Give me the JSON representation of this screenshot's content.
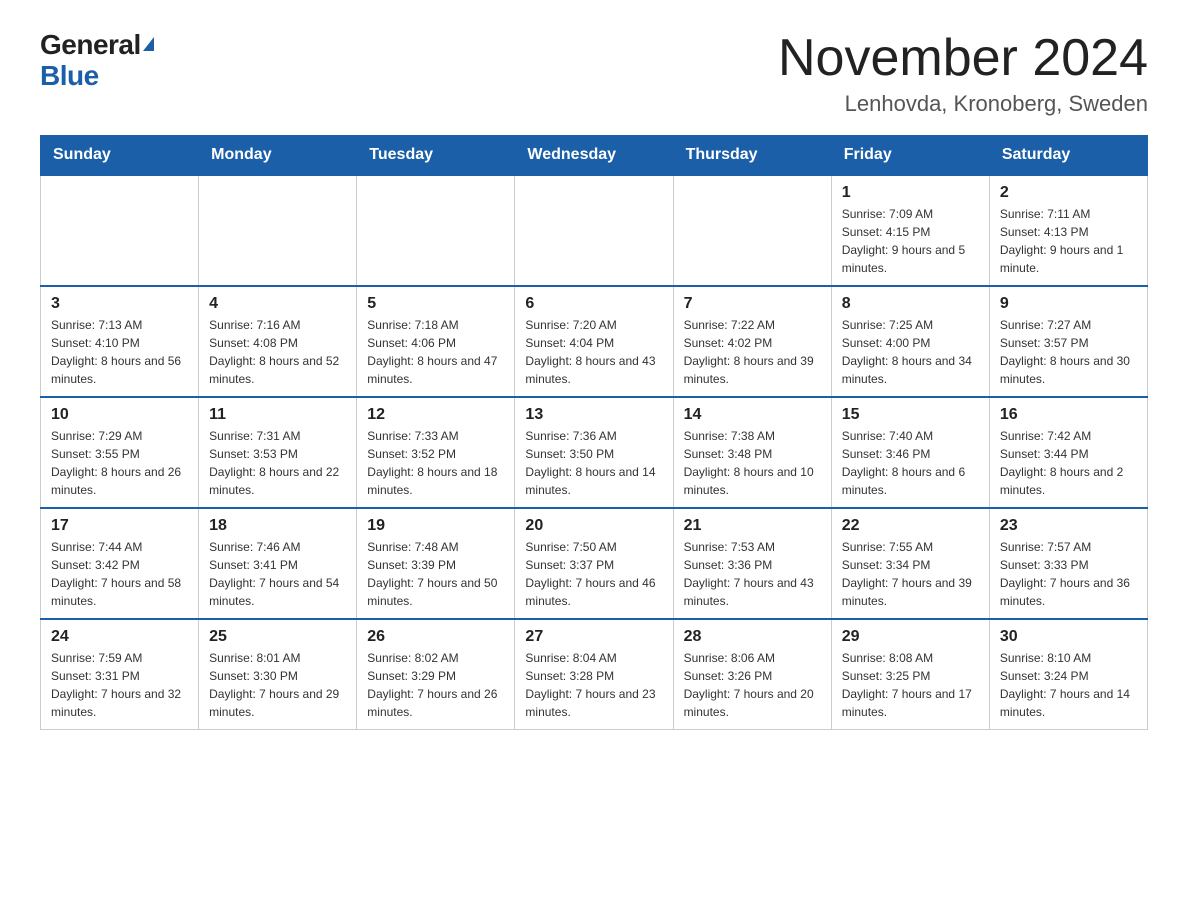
{
  "logo": {
    "text_general": "General",
    "text_blue": "Blue"
  },
  "title": "November 2024",
  "subtitle": "Lenhovda, Kronoberg, Sweden",
  "days_of_week": [
    "Sunday",
    "Monday",
    "Tuesday",
    "Wednesday",
    "Thursday",
    "Friday",
    "Saturday"
  ],
  "weeks": [
    [
      {
        "day": "",
        "info": ""
      },
      {
        "day": "",
        "info": ""
      },
      {
        "day": "",
        "info": ""
      },
      {
        "day": "",
        "info": ""
      },
      {
        "day": "",
        "info": ""
      },
      {
        "day": "1",
        "info": "Sunrise: 7:09 AM\nSunset: 4:15 PM\nDaylight: 9 hours and 5 minutes."
      },
      {
        "day": "2",
        "info": "Sunrise: 7:11 AM\nSunset: 4:13 PM\nDaylight: 9 hours and 1 minute."
      }
    ],
    [
      {
        "day": "3",
        "info": "Sunrise: 7:13 AM\nSunset: 4:10 PM\nDaylight: 8 hours and 56 minutes."
      },
      {
        "day": "4",
        "info": "Sunrise: 7:16 AM\nSunset: 4:08 PM\nDaylight: 8 hours and 52 minutes."
      },
      {
        "day": "5",
        "info": "Sunrise: 7:18 AM\nSunset: 4:06 PM\nDaylight: 8 hours and 47 minutes."
      },
      {
        "day": "6",
        "info": "Sunrise: 7:20 AM\nSunset: 4:04 PM\nDaylight: 8 hours and 43 minutes."
      },
      {
        "day": "7",
        "info": "Sunrise: 7:22 AM\nSunset: 4:02 PM\nDaylight: 8 hours and 39 minutes."
      },
      {
        "day": "8",
        "info": "Sunrise: 7:25 AM\nSunset: 4:00 PM\nDaylight: 8 hours and 34 minutes."
      },
      {
        "day": "9",
        "info": "Sunrise: 7:27 AM\nSunset: 3:57 PM\nDaylight: 8 hours and 30 minutes."
      }
    ],
    [
      {
        "day": "10",
        "info": "Sunrise: 7:29 AM\nSunset: 3:55 PM\nDaylight: 8 hours and 26 minutes."
      },
      {
        "day": "11",
        "info": "Sunrise: 7:31 AM\nSunset: 3:53 PM\nDaylight: 8 hours and 22 minutes."
      },
      {
        "day": "12",
        "info": "Sunrise: 7:33 AM\nSunset: 3:52 PM\nDaylight: 8 hours and 18 minutes."
      },
      {
        "day": "13",
        "info": "Sunrise: 7:36 AM\nSunset: 3:50 PM\nDaylight: 8 hours and 14 minutes."
      },
      {
        "day": "14",
        "info": "Sunrise: 7:38 AM\nSunset: 3:48 PM\nDaylight: 8 hours and 10 minutes."
      },
      {
        "day": "15",
        "info": "Sunrise: 7:40 AM\nSunset: 3:46 PM\nDaylight: 8 hours and 6 minutes."
      },
      {
        "day": "16",
        "info": "Sunrise: 7:42 AM\nSunset: 3:44 PM\nDaylight: 8 hours and 2 minutes."
      }
    ],
    [
      {
        "day": "17",
        "info": "Sunrise: 7:44 AM\nSunset: 3:42 PM\nDaylight: 7 hours and 58 minutes."
      },
      {
        "day": "18",
        "info": "Sunrise: 7:46 AM\nSunset: 3:41 PM\nDaylight: 7 hours and 54 minutes."
      },
      {
        "day": "19",
        "info": "Sunrise: 7:48 AM\nSunset: 3:39 PM\nDaylight: 7 hours and 50 minutes."
      },
      {
        "day": "20",
        "info": "Sunrise: 7:50 AM\nSunset: 3:37 PM\nDaylight: 7 hours and 46 minutes."
      },
      {
        "day": "21",
        "info": "Sunrise: 7:53 AM\nSunset: 3:36 PM\nDaylight: 7 hours and 43 minutes."
      },
      {
        "day": "22",
        "info": "Sunrise: 7:55 AM\nSunset: 3:34 PM\nDaylight: 7 hours and 39 minutes."
      },
      {
        "day": "23",
        "info": "Sunrise: 7:57 AM\nSunset: 3:33 PM\nDaylight: 7 hours and 36 minutes."
      }
    ],
    [
      {
        "day": "24",
        "info": "Sunrise: 7:59 AM\nSunset: 3:31 PM\nDaylight: 7 hours and 32 minutes."
      },
      {
        "day": "25",
        "info": "Sunrise: 8:01 AM\nSunset: 3:30 PM\nDaylight: 7 hours and 29 minutes."
      },
      {
        "day": "26",
        "info": "Sunrise: 8:02 AM\nSunset: 3:29 PM\nDaylight: 7 hours and 26 minutes."
      },
      {
        "day": "27",
        "info": "Sunrise: 8:04 AM\nSunset: 3:28 PM\nDaylight: 7 hours and 23 minutes."
      },
      {
        "day": "28",
        "info": "Sunrise: 8:06 AM\nSunset: 3:26 PM\nDaylight: 7 hours and 20 minutes."
      },
      {
        "day": "29",
        "info": "Sunrise: 8:08 AM\nSunset: 3:25 PM\nDaylight: 7 hours and 17 minutes."
      },
      {
        "day": "30",
        "info": "Sunrise: 8:10 AM\nSunset: 3:24 PM\nDaylight: 7 hours and 14 minutes."
      }
    ]
  ]
}
